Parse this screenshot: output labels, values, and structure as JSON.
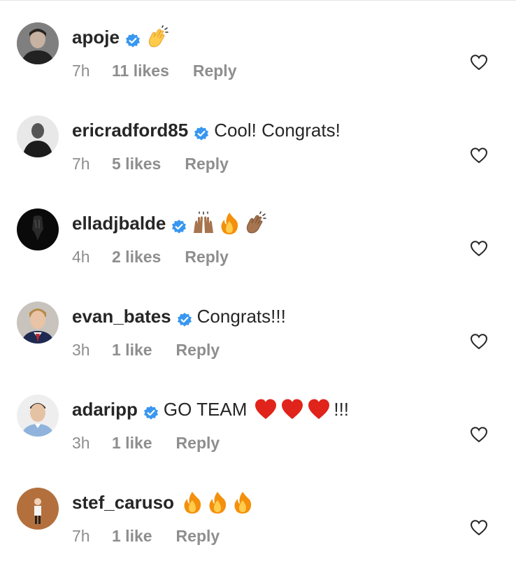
{
  "comments": [
    {
      "username": "apoje",
      "text": "",
      "emojis": [
        "clap"
      ],
      "time": "7h",
      "likes": "11 likes",
      "reply": "Reply",
      "avatar": "avatar-apoje"
    },
    {
      "username": "ericradford85",
      "text": "Cool! Congrats!",
      "emojis": [],
      "time": "7h",
      "likes": "5 likes",
      "reply": "Reply",
      "avatar": "avatar-ericradford85"
    },
    {
      "username": "elladjbalde",
      "text": "",
      "emojis": [
        "raising-hands",
        "fire",
        "clap-dark"
      ],
      "time": "4h",
      "likes": "2 likes",
      "reply": "Reply",
      "avatar": "avatar-elladjbalde"
    },
    {
      "username": "evan_bates",
      "text": "Congrats!!!",
      "emojis": [],
      "time": "3h",
      "likes": "1 like",
      "reply": "Reply",
      "avatar": "avatar-evan-bates"
    },
    {
      "username": "adaripp",
      "text": "GO TEAM",
      "emojis": [
        "heart",
        "heart",
        "heart"
      ],
      "suffix": "!!!",
      "time": "3h",
      "likes": "1 like",
      "reply": "Reply",
      "avatar": "avatar-adaripp"
    },
    {
      "username": "stef_caruso",
      "text": "",
      "emojis": [
        "fire",
        "fire",
        "fire"
      ],
      "time": "7h",
      "likes": "1 like",
      "reply": "Reply",
      "avatar": "avatar-stef-caruso"
    }
  ],
  "icons": {
    "verified": "verified-badge-icon",
    "like": "heart-outline-icon"
  },
  "colors": {
    "verified": "#3897f0",
    "muted": "#8e8e8e",
    "text": "#262626",
    "heart": "#e0241b",
    "fire": "#f4900c"
  }
}
